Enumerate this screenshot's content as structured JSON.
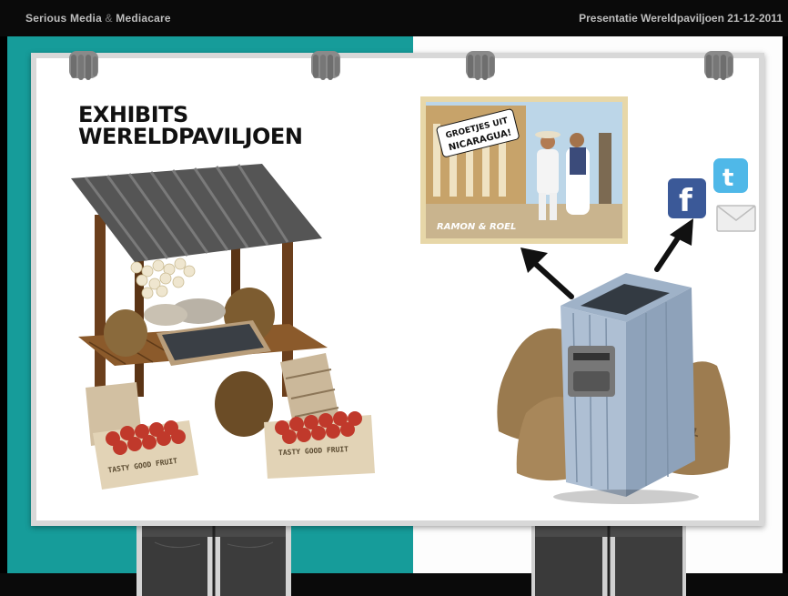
{
  "header": {
    "brand_part1": "Serious Media",
    "brand_amp": "&",
    "brand_part2": "Mediacare",
    "presentation_title": "Presentatie Wereldpaviljoen 21-12-2011"
  },
  "board": {
    "title_line1": "EXHIBITS",
    "title_line2": "WERELDPAVILJOEN"
  },
  "postcard": {
    "caption_line1": "GROETJES UIT",
    "caption_line2": "NICARAGUA!",
    "signature": "RAMON & ROEL"
  },
  "market_stall": {
    "crate_left_label": "TASTY GOOD FRUIT",
    "crate_right_label": "TASTY GOOD FRUIT"
  },
  "mail_sacks": {
    "label": "MAIL"
  },
  "social_icons": [
    "facebook-icon",
    "twitter-icon",
    "envelope-icon"
  ],
  "colors": {
    "teal": "#169c9a",
    "bar": "#0a0a0a",
    "facebook": "#3b5998",
    "twitter": "#4fb8e8"
  }
}
